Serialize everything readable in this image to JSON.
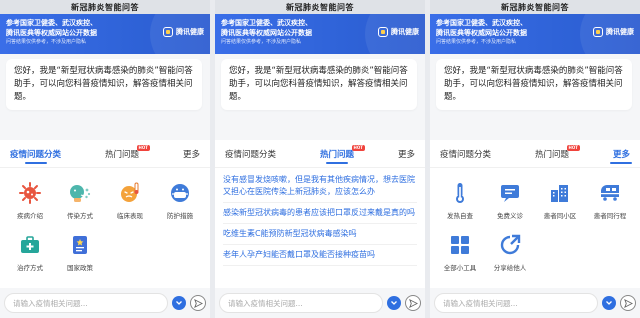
{
  "app_title": "新冠肺炎智能问答",
  "banner": {
    "line1": "参考国家卫健委、武汉疾控、",
    "line2": "腾讯医典等权威网站公开数据",
    "line3": "问答结果仅供参考，不涉及用户隐私",
    "brand": "腾讯健康"
  },
  "greeting": "您好，我是“新型冠状病毒感染的肺炎”智能问答助手，可以向您科普疫情知识，解答疫情相关问题。",
  "tabs": {
    "categories": "疫情问题分类",
    "hot": "热门问题",
    "hot_badge": "HOT",
    "more": "更多"
  },
  "categories": [
    {
      "label": "疾病介绍",
      "icon": "virus-icon"
    },
    {
      "label": "传染方式",
      "icon": "sneeze-icon"
    },
    {
      "label": "临床表现",
      "icon": "fever-face-icon"
    },
    {
      "label": "防护措施",
      "icon": "mask-icon"
    },
    {
      "label": "治疗方式",
      "icon": "medical-kit-icon"
    },
    {
      "label": "国家政策",
      "icon": "policy-document-icon"
    }
  ],
  "hot_questions": [
    "没有感冒发烧咳嗽，但是我有其他疾病情况，想去医院又担心在医院传染上新冠肺炎，应该怎么办",
    "感染新型冠状病毒的患者应该把口罩反过来戴是真的吗",
    "吃维生素C能预防新型冠状病毒感染吗",
    "老年人孕产妇能否戴口罩及能否接种疫苗吗"
  ],
  "more_tools": [
    {
      "label": "发热自查",
      "icon": "thermometer-icon"
    },
    {
      "label": "免费义诊",
      "icon": "chat-consult-icon"
    },
    {
      "label": "患者同小区",
      "icon": "community-buildings-icon"
    },
    {
      "label": "患者同行程",
      "icon": "train-icon"
    },
    {
      "label": "全部小工具",
      "icon": "grid-apps-icon"
    },
    {
      "label": "分享给他人",
      "icon": "share-icon"
    }
  ],
  "input": {
    "placeholder": "请输入疫情相关问题..."
  },
  "colors": {
    "accent": "#2f6fe0",
    "hot_badge": "#f0433c"
  }
}
